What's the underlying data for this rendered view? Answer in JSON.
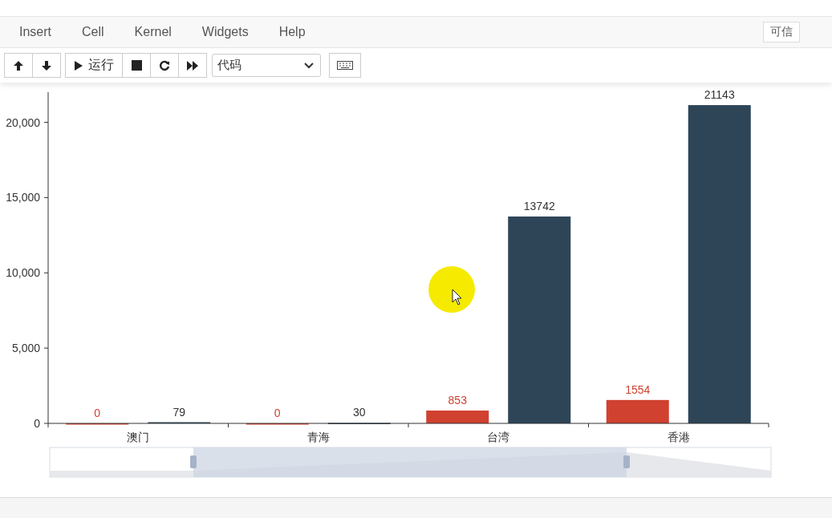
{
  "menu": [
    {
      "label": "Insert"
    },
    {
      "label": "Cell"
    },
    {
      "label": "Kernel"
    },
    {
      "label": "Widgets"
    },
    {
      "label": "Help"
    }
  ],
  "trusted_badge": "可信",
  "toolbar": {
    "run_label": "运行",
    "cell_type": "代码"
  },
  "chart": {
    "chart_data": {
      "type": "bar",
      "categories": [
        "澳门",
        "青海",
        "台湾",
        "香港"
      ],
      "series": [
        {
          "color": "#d04130",
          "values": [
            0,
            0,
            853,
            1554
          ]
        },
        {
          "color": "#2e4558",
          "values": [
            79,
            30,
            13742,
            21143
          ]
        }
      ],
      "ylim": [
        0,
        22000
      ],
      "yticks": [
        0,
        {
          "value": 5000,
          "label": "5,000"
        },
        {
          "value": 10000,
          "label": "10,000"
        },
        {
          "value": 15000,
          "label": "15,000"
        },
        {
          "value": 20000,
          "label": "20,000"
        }
      ],
      "data_labels": true
    }
  }
}
